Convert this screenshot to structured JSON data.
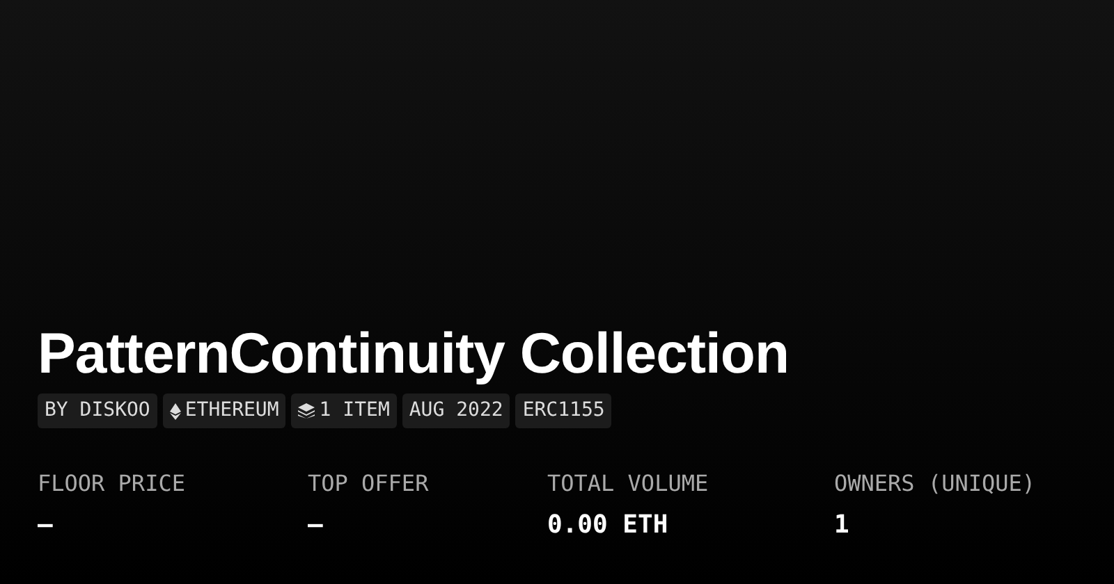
{
  "title": "PatternContinuity Collection",
  "tags": [
    {
      "label": "BY DISKOO",
      "kind": "text"
    },
    {
      "label": "ETHEREUM",
      "kind": "ethereum"
    },
    {
      "label": "1 ITEM",
      "kind": "layers"
    },
    {
      "label": "AUG 2022",
      "kind": "text"
    },
    {
      "label": "ERC1155",
      "kind": "text"
    }
  ],
  "stats": [
    {
      "label": "FLOOR PRICE",
      "value": "—"
    },
    {
      "label": "TOP OFFER",
      "value": "—"
    },
    {
      "label": "TOTAL VOLUME",
      "value": "0.00 ETH"
    },
    {
      "label": "OWNERS (UNIQUE)",
      "value": "1"
    }
  ]
}
